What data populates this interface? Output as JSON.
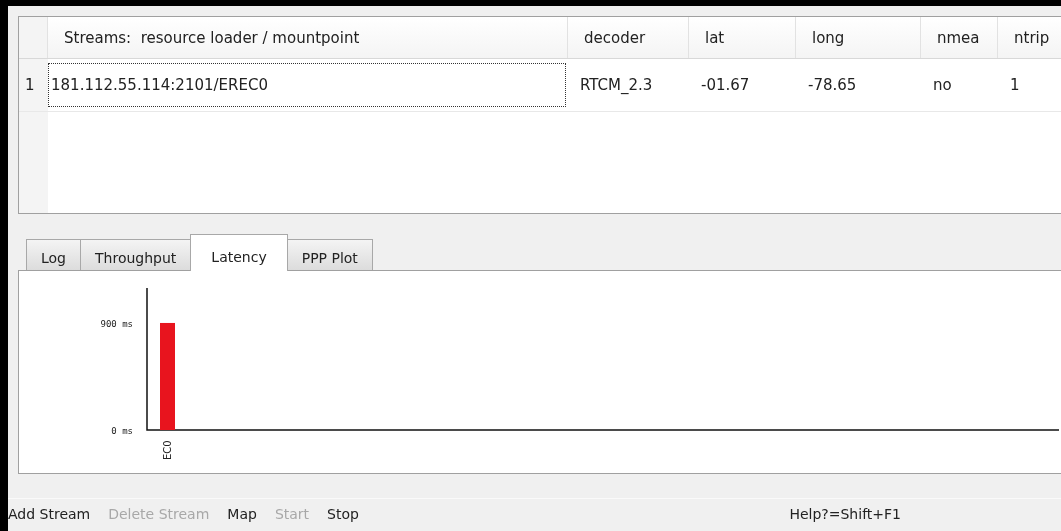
{
  "table": {
    "columns": [
      "Streams:  resource loader / mountpoint",
      "decoder",
      "lat",
      "long",
      "nmea",
      "ntrip"
    ],
    "rows": [
      {
        "number": "1",
        "cells": [
          "181.112.55.114:2101/EREC0",
          "RTCM_2.3",
          "-01.67",
          "-78.65",
          "no",
          "1"
        ],
        "selected": true
      }
    ]
  },
  "tabs": [
    {
      "label": "Log",
      "selected": false
    },
    {
      "label": "Throughput",
      "selected": false
    },
    {
      "label": "Latency",
      "selected": true
    },
    {
      "label": "PPP Plot",
      "selected": false
    }
  ],
  "chart_data": {
    "type": "bar",
    "categories": [
      "EC0"
    ],
    "values": [
      900
    ],
    "ylim": [
      0,
      1194
    ],
    "yticks": [
      {
        "value": 0,
        "label": "0 ms"
      },
      {
        "value": 900,
        "label": "900 ms"
      }
    ]
  },
  "toolbar": [
    {
      "label": "Add Stream",
      "disabled": false
    },
    {
      "label": "Delete Stream",
      "disabled": true
    },
    {
      "label": "Map",
      "disabled": false
    },
    {
      "label": "Start",
      "disabled": true
    },
    {
      "label": "Stop",
      "disabled": false
    }
  ],
  "status": "Help?=Shift+F1"
}
